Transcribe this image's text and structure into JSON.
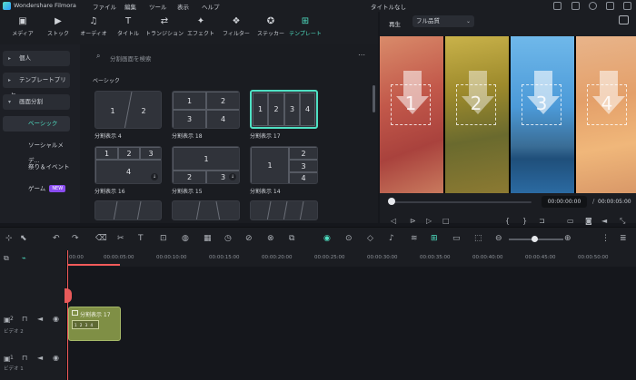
{
  "titlebar": {
    "app_name": "Wondershare Filmora",
    "menus": [
      "ファイル",
      "編集",
      "ツール",
      "表示",
      "ヘルプ"
    ],
    "document_title": "タイトルなし"
  },
  "toolbar": {
    "items": [
      {
        "label": "メディア",
        "icon": "media-icon"
      },
      {
        "label": "ストック",
        "icon": "stock-icon"
      },
      {
        "label": "オーディオ",
        "icon": "music-note-icon"
      },
      {
        "label": "タイトル",
        "icon": "title-t-icon"
      },
      {
        "label": "トランジション",
        "icon": "transition-icon"
      },
      {
        "label": "エフェクト",
        "icon": "effect-sparkle-icon"
      },
      {
        "label": "フィルター",
        "icon": "filter-icon"
      },
      {
        "label": "ステッカー",
        "icon": "sticker-icon"
      },
      {
        "label": "テンプレート",
        "icon": "template-icon"
      }
    ],
    "active_index": 8
  },
  "sidebar": {
    "items": [
      {
        "label": "個人"
      },
      {
        "label": "テンプレートプリセ..."
      },
      {
        "label": "画面分割"
      },
      {
        "label": "ベーシック"
      },
      {
        "label": "ソーシャルメデ..."
      },
      {
        "label": "祭り＆イベント"
      },
      {
        "label": "ゲーム",
        "badge": "NEW"
      }
    ]
  },
  "gallery": {
    "search_placeholder": "分割画面を検索",
    "section_title": "ベーシック",
    "tiles": [
      {
        "name": "分割表示 4",
        "cells": [
          "1",
          "2"
        ]
      },
      {
        "name": "分割表示 18",
        "cells": [
          "1",
          "2",
          "3",
          "4"
        ]
      },
      {
        "name": "分割表示 17",
        "cells": [
          "1",
          "2",
          "3",
          "4"
        ]
      },
      {
        "name": "分割表示 16",
        "cells": [
          "1",
          "2",
          "3",
          "4"
        ]
      },
      {
        "name": "分割表示 15",
        "cells": [
          "1",
          "2",
          "3"
        ]
      },
      {
        "name": "分割表示 14",
        "cells": [
          "1",
          "2",
          "3",
          "4"
        ]
      }
    ]
  },
  "player": {
    "tab_label": "再生",
    "quality": "フル品質",
    "panes": [
      "1",
      "2",
      "3",
      "4"
    ],
    "current_time": "00:00:00:00",
    "total_time": "00:00:05:00",
    "progress": 0
  },
  "timeline": {
    "ruler_ticks": [
      "00:00",
      "00:00:05:00",
      "00:00:10:00",
      "00:00:15:00",
      "00:00:20:00",
      "00:00:25:00",
      "00:00:30:00",
      "00:00:35:00",
      "00:00:40:00",
      "00:00:45:00",
      "00:00:50:00"
    ],
    "tracks": [
      {
        "number": "2",
        "name": "ビデオ 2"
      },
      {
        "number": "1",
        "name": "ビデオ 1"
      }
    ],
    "clip_label": "分割表示 17",
    "clip_thumb": "1 2 3 4"
  },
  "colors": {
    "accent": "#4fe0c3",
    "playhead": "#f25a5a",
    "clip": "#7f8f45"
  }
}
